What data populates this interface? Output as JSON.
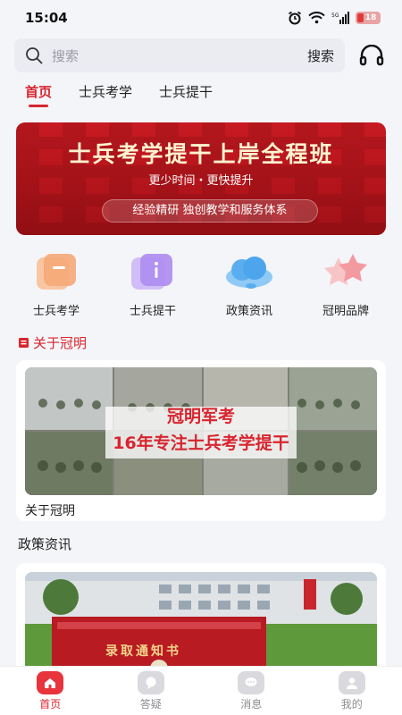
{
  "status": {
    "time": "15:04",
    "battery": "18",
    "network": "5G"
  },
  "search": {
    "placeholder": "搜索",
    "button": "搜索",
    "icon": "search-icon",
    "support_icon": "headset-icon"
  },
  "tabs": [
    {
      "label": "首页",
      "active": true
    },
    {
      "label": "士兵考学",
      "active": false
    },
    {
      "label": "士兵提干",
      "active": false
    }
  ],
  "banner": {
    "title": "士兵考学提干上岸全程班",
    "subtitle": "更少时间・更快提升",
    "pill": "经验精研 独创教学和服务体系"
  },
  "categories": [
    {
      "label": "士兵考学",
      "icon": "card-icon",
      "color": "#f6b38a"
    },
    {
      "label": "士兵提干",
      "icon": "info-icon",
      "color": "#b99af1"
    },
    {
      "label": "政策资讯",
      "icon": "cloud-icon",
      "color": "#66b7f2"
    },
    {
      "label": "冠明品牌",
      "icon": "star-icon",
      "color": "#f6a3a7"
    }
  ],
  "about": {
    "section_title": "关于冠明",
    "overlay_line1": "冠明军考",
    "overlay_line2": "16年专注士兵考学提干",
    "caption": "关于冠明"
  },
  "policy": {
    "section_title": "政策资讯",
    "image_text": "录取通知书"
  },
  "bottom_nav": [
    {
      "label": "首页",
      "icon": "home-icon",
      "active": true
    },
    {
      "label": "答疑",
      "icon": "answer-icon",
      "active": false
    },
    {
      "label": "消息",
      "icon": "message-icon",
      "active": false
    },
    {
      "label": "我的",
      "icon": "profile-icon",
      "active": false
    }
  ],
  "colors": {
    "accent": "#d8252f",
    "background": "#f4f5f8"
  }
}
